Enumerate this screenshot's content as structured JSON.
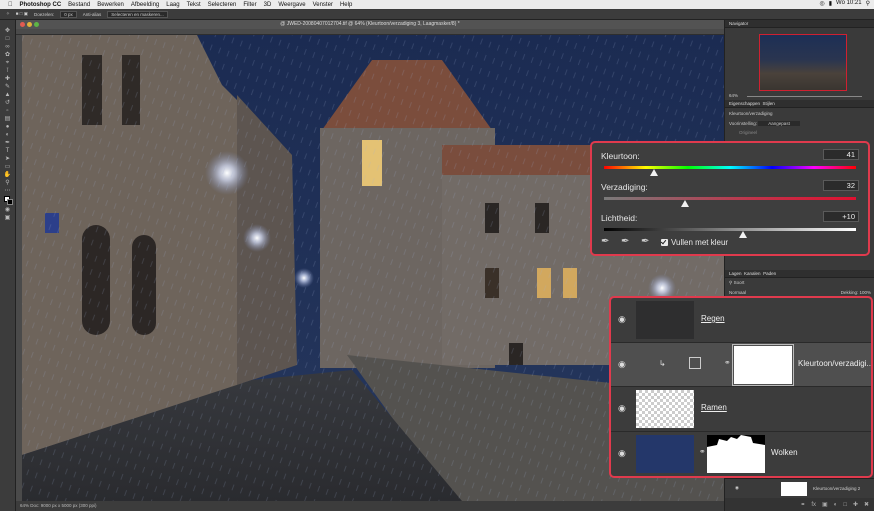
{
  "menubar": {
    "app": "Photoshop CC",
    "items": [
      "Bestand",
      "Bewerken",
      "Afbeelding",
      "Laag",
      "Tekst",
      "Selecteren",
      "Filter",
      "3D",
      "Weergave",
      "Venster",
      "Help"
    ],
    "clock": "Wo 10:21"
  },
  "options": {
    "doezelen_label": "Doezelen:",
    "doezelen_value": "0 px",
    "anti_alias": "Anti-alias",
    "select_mask_button": "Selecteren en maskeren..."
  },
  "document": {
    "tab_title": "@ JWED-20080407012704.tif @ 64% (Kleurtoon/verzadiging 3, Laagmasker/8) *",
    "status": "64%   Doc: 9000 px x 5000 px (300 ppi)"
  },
  "navigator": {
    "title": "Navigator",
    "zoom": "64%"
  },
  "properties": {
    "tabs": [
      "Eigenschappen",
      "Stijlen"
    ],
    "adjustment_name": "Kleurtoon/verzadiging",
    "preset_label": "Voorinstelling:",
    "preset_value": "Aangepast",
    "channel_value": "Origineel"
  },
  "huesat": {
    "hue_label": "Kleurtoon:",
    "hue_value": "41",
    "hue_pos": 0.2,
    "sat_label": "Verzadiging:",
    "sat_value": "32",
    "sat_pos": 0.32,
    "light_label": "Lichtheid:",
    "light_value": "+10",
    "light_pos": 0.55,
    "colorize_label": "Vullen met kleur",
    "colorize_checked": true
  },
  "layers_panel": {
    "tabs": [
      "Lagen",
      "Kanalen",
      "Paden"
    ],
    "kind_value": "Soort",
    "blend_mode": "Normaal",
    "opacity_label": "Dekking:",
    "opacity_value": "100%",
    "fill_label": "Vullen:",
    "fill_value": "100%",
    "bottom_layer_name": "Kleurtoon/verzadiging 2",
    "layers": [
      {
        "name": "Regen",
        "underlined": true
      },
      {
        "name": "Kleurtoon/verzadigi...",
        "underlined": false,
        "selected": true
      },
      {
        "name": "Ramen",
        "underlined": true
      },
      {
        "name": "Wolken",
        "underlined": false
      }
    ]
  },
  "colors": {
    "accent_outline": "#e03a4d",
    "panel_bg": "#3c3c3c",
    "sky": "#1f2f55"
  }
}
